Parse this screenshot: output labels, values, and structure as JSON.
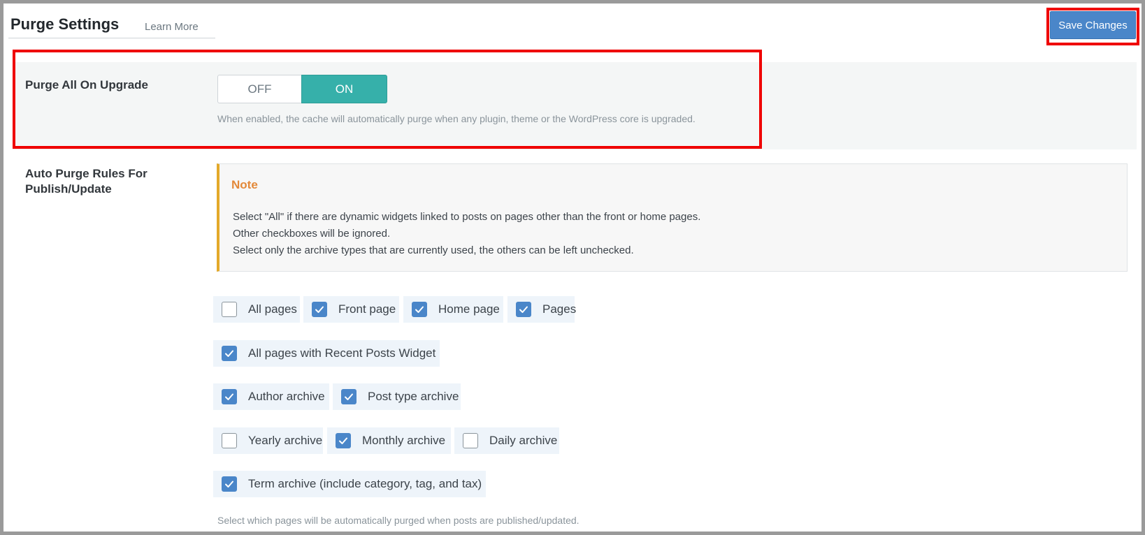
{
  "header": {
    "title": "Purge Settings",
    "learn_more": "Learn More",
    "save_label": "Save Changes"
  },
  "upgrade": {
    "label": "Purge All On Upgrade",
    "off_label": "OFF",
    "on_label": "ON",
    "state": "ON",
    "description": "When enabled, the cache will automatically purge when any plugin, theme or the WordPress core is upgraded."
  },
  "auto_purge": {
    "label_line1": "Auto Purge Rules For",
    "label_line2": "Publish/Update",
    "note_title": "Note",
    "note_lines": [
      "Select \"All\" if there are dynamic widgets linked to posts on pages other than the front or home pages.",
      "Other checkboxes will be ignored.",
      "Select only the archive types that are currently used, the others can be left unchecked."
    ],
    "checkboxes": [
      {
        "label": "All pages",
        "checked": false
      },
      {
        "label": "Front page",
        "checked": true
      },
      {
        "label": "Home page",
        "checked": true
      },
      {
        "label": "Pages",
        "checked": true
      },
      {
        "label": "All pages with Recent Posts Widget",
        "checked": true
      },
      {
        "label": "Author archive",
        "checked": true
      },
      {
        "label": "Post type archive",
        "checked": true
      },
      {
        "label": "Yearly archive",
        "checked": false
      },
      {
        "label": "Monthly archive",
        "checked": true
      },
      {
        "label": "Daily archive",
        "checked": false
      },
      {
        "label": "Term archive (include category, tag, and tax)",
        "checked": true
      }
    ],
    "description": "Select which pages will be automatically purged when posts are published/updated."
  },
  "colors": {
    "accent": "#4a86c9",
    "toggle_on": "#36b0aa",
    "highlight": "#ef0000",
    "note_border": "#e3a92a",
    "note_title": "#e3893a"
  }
}
